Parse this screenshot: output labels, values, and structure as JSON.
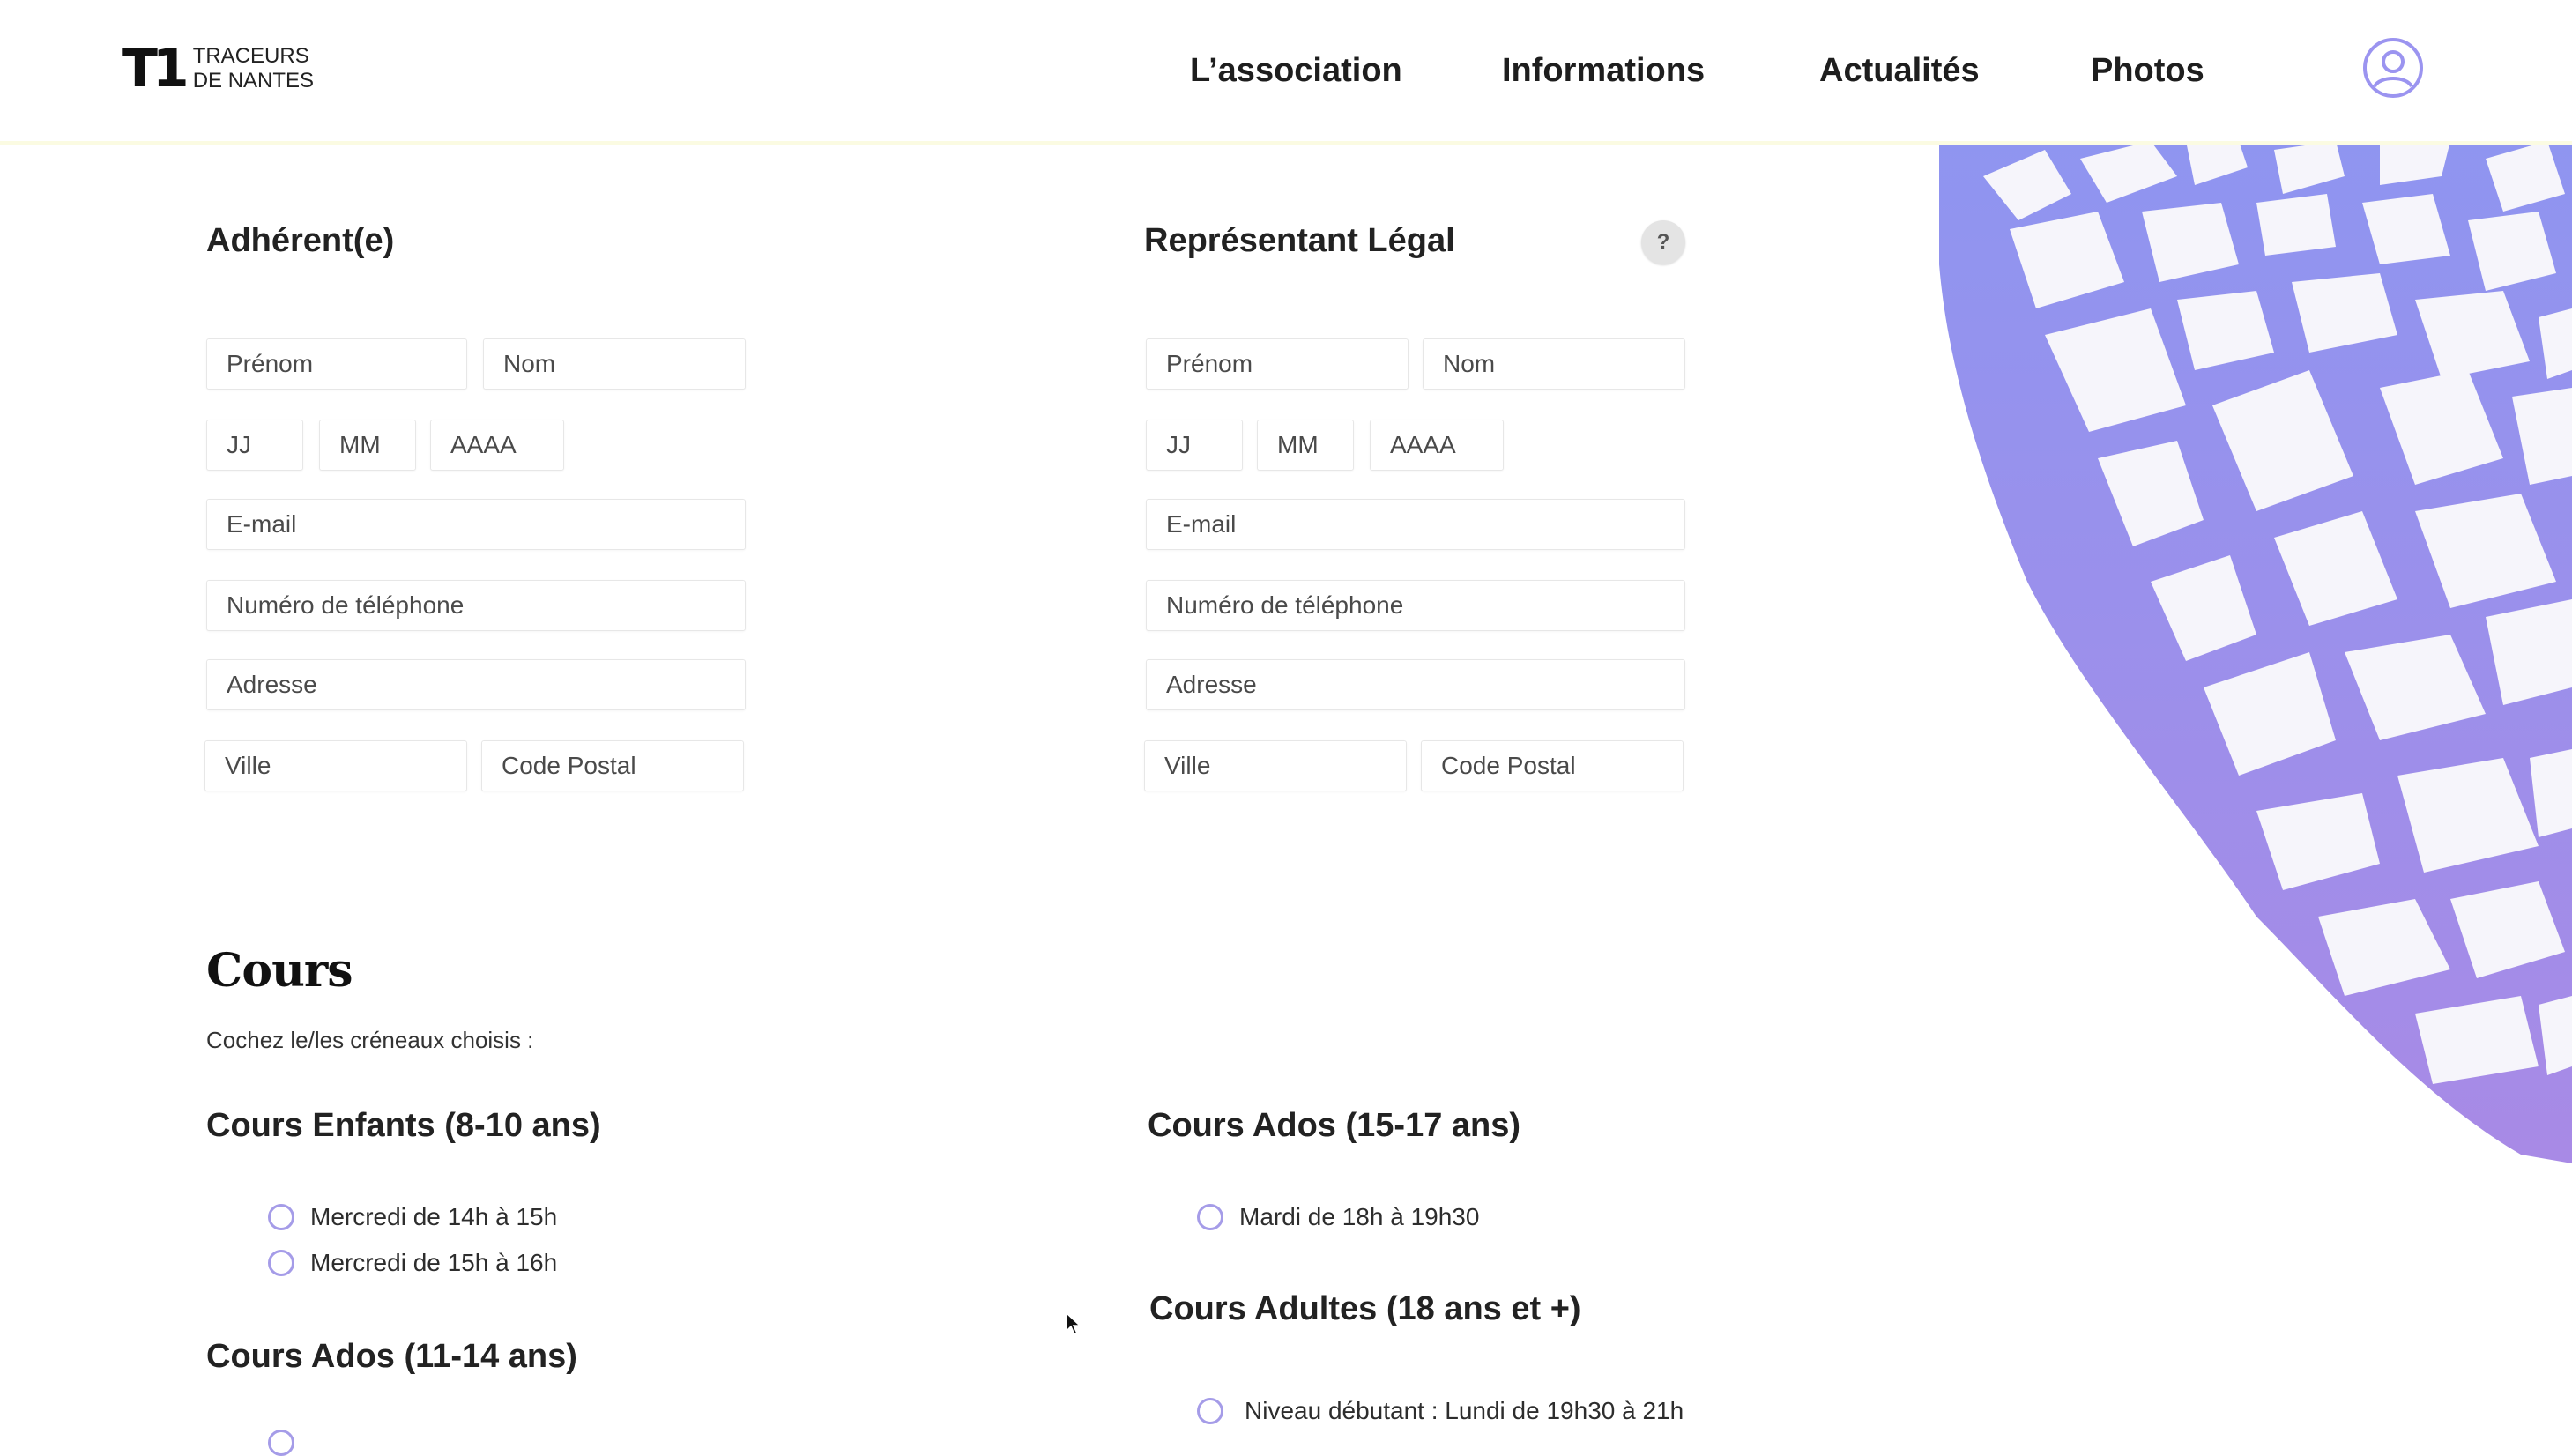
{
  "brand": {
    "mark": "T1",
    "line1": "TRACEURS",
    "line2": "DE NANTES"
  },
  "nav": [
    "L’association",
    "Informations",
    "Actualités",
    "Photos"
  ],
  "adherent": {
    "title": "Adhérent(e)",
    "prenom": "Prénom",
    "nom": "Nom",
    "jj": "JJ",
    "mm": "MM",
    "aaaa": "AAAA",
    "email": "E-mail",
    "telephone": "Numéro de téléphone",
    "adresse": "Adresse",
    "ville": "Ville",
    "code_postal": "Code Postal"
  },
  "representant": {
    "title": "Représentant Légal",
    "help": "?",
    "prenom": "Prénom",
    "nom": "Nom",
    "jj": "JJ",
    "mm": "MM",
    "aaaa": "AAAA",
    "email": "E-mail",
    "telephone": "Numéro de téléphone",
    "adresse": "Adresse",
    "ville": "Ville",
    "code_postal": "Code Postal"
  },
  "cours": {
    "title": "Cours",
    "instruction": "Cochez le/les créneaux choisis :",
    "enfants": {
      "title": "Cours Enfants (8-10 ans)",
      "options": [
        "Mercredi de 14h à 15h",
        "Mercredi de 15h à 16h"
      ]
    },
    "ados_11_14": {
      "title": "Cours Ados (11-14 ans)"
    },
    "ados_15_17": {
      "title": "Cours Ados (15-17 ans)",
      "options": [
        "Mardi de 18h à 19h30"
      ]
    },
    "adultes": {
      "title": "Cours Adultes (18 ans et +)",
      "options": [
        "Niveau débutant : Lundi de 19h30 à 21h"
      ]
    }
  },
  "colors": {
    "accent": "#9b94f0",
    "radio_border": "#a59ce8",
    "header_border": "#fbfbe2"
  },
  "icons": [
    "user-icon",
    "help-icon",
    "mouse-cursor-icon"
  ]
}
